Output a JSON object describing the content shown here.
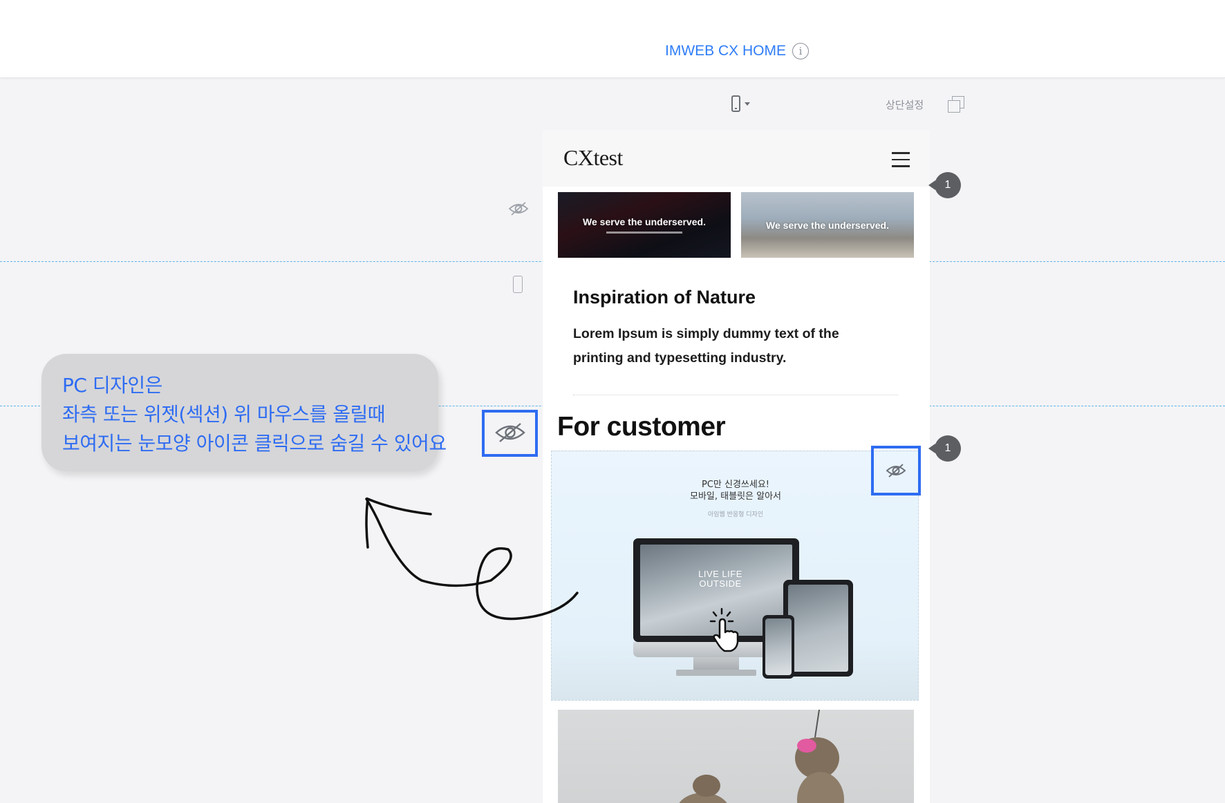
{
  "topbar": {
    "site_title": "IMWEB CX HOME",
    "info_glyph": "i"
  },
  "toolbar": {
    "device": "mobile",
    "header_settings_label": "상단설정"
  },
  "mobile_preview": {
    "logo": "CXtest",
    "banners": [
      {
        "text": "We serve the underserved."
      },
      {
        "text": "We serve the underserved."
      }
    ],
    "inspiration": {
      "title": "Inspiration of Nature",
      "body": "Lorem Ipsum is simply dummy text of the printing and typesetting industry."
    },
    "customer_section": {
      "title": "For customer",
      "promo_headline_1": "PC만 신경쓰세요!",
      "promo_headline_2": "모바일, 태블릿은 알아서",
      "promo_small": "아임웹 반응형 디자인",
      "screen_text": "LIVE LIFE OUTSIDE"
    }
  },
  "badges": [
    {
      "count": "1"
    },
    {
      "count": "1"
    }
  ],
  "callout": {
    "line1": "PC 디자인은",
    "line2": "좌측 또는 위젯(섹션) 위 마우스를 올릴때",
    "line3": "보여지는 눈모양 아이콘 클릭으로 숨길 수 있어요"
  },
  "colors": {
    "accent": "#2e6cf2",
    "title_blue": "#2f7df6",
    "guide": "#5bb3ea",
    "badge": "#5c5e62"
  }
}
